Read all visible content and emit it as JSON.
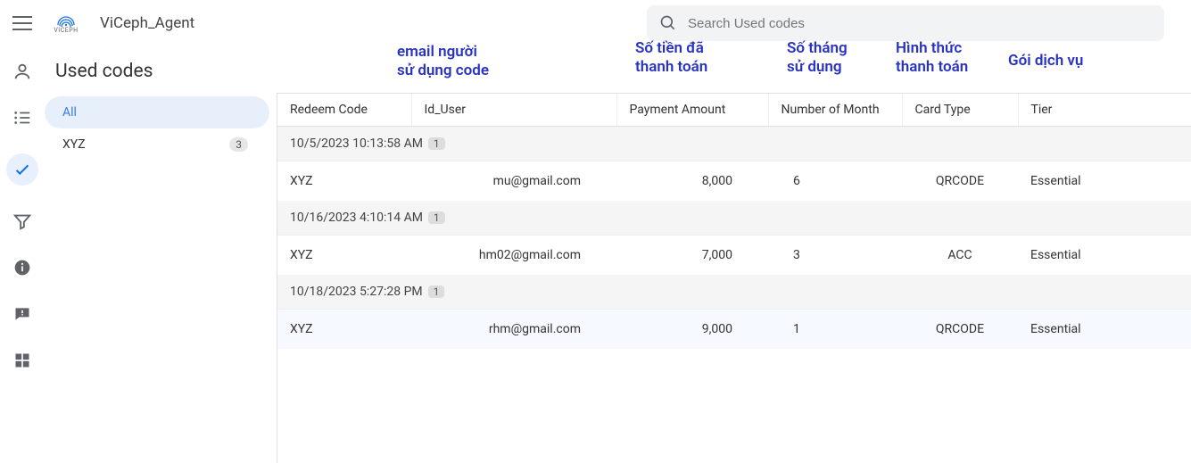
{
  "header": {
    "app_title": "ViCeph_Agent",
    "logo_caption": "VICEPH",
    "search_placeholder": "Search Used codes"
  },
  "page": {
    "title": "Used codes"
  },
  "filters": {
    "items": [
      {
        "label": "All",
        "count": ""
      },
      {
        "label": "XYZ",
        "count": "3"
      }
    ]
  },
  "annotations": {
    "email": "email người\nsử dụng code",
    "amount": "Số tiền đã\nthanh toán",
    "months": "Số tháng\nsử dụng",
    "cardtype": "Hình thức\nthanh toán",
    "tier": "Gói dịch vụ"
  },
  "table": {
    "columns": {
      "redeem": "Redeem Code",
      "user": "Id_User",
      "amount": "Payment Amount",
      "month": "Number of Month",
      "card": "Card Type",
      "tier": "Tier"
    },
    "groups": [
      {
        "timestamp": "10/5/2023 10:13:58 AM",
        "badge": "1",
        "rows": [
          {
            "redeem": "XYZ",
            "user": "mu@gmail.com",
            "amount": "8,000",
            "month": "6",
            "card": "QRCODE",
            "tier": "Essential"
          }
        ]
      },
      {
        "timestamp": "10/16/2023 4:10:14 AM",
        "badge": "1",
        "rows": [
          {
            "redeem": "XYZ",
            "user": "hm02@gmail.com",
            "amount": "7,000",
            "month": "3",
            "card": "ACC",
            "tier": "Essential"
          }
        ]
      },
      {
        "timestamp": "10/18/2023 5:27:28 PM",
        "badge": "1",
        "rows": [
          {
            "redeem": "XYZ",
            "user": "rhm@gmail.com",
            "amount": "9,000",
            "month": "1",
            "card": "QRCODE",
            "tier": "Essential"
          }
        ]
      }
    ]
  }
}
